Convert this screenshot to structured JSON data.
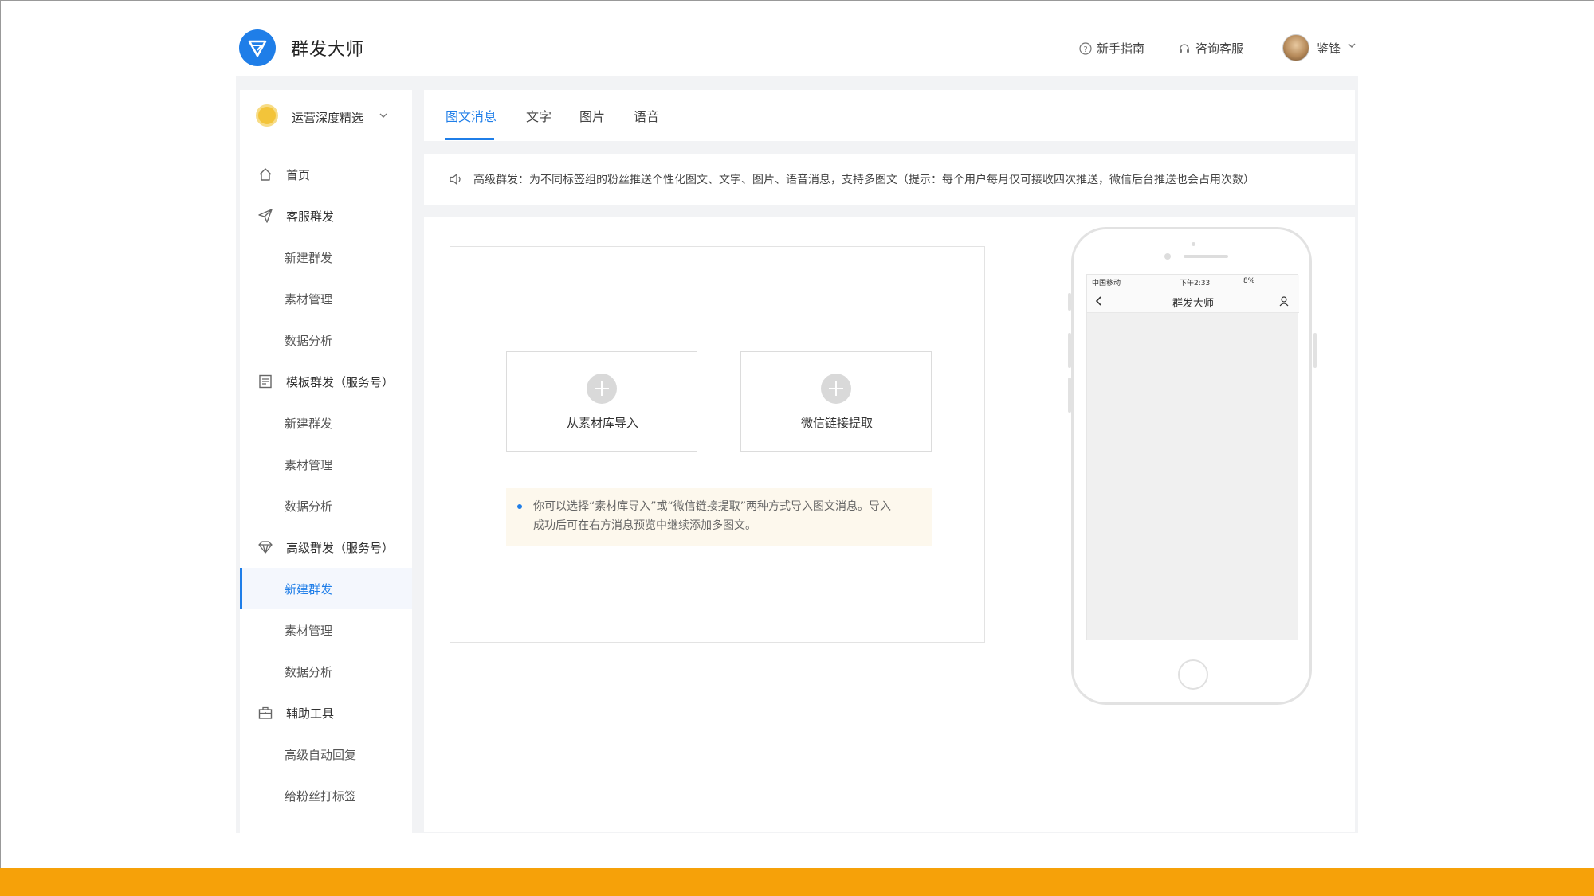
{
  "app": {
    "title": "群发大师",
    "brand_color": "#1f7ee8",
    "accent_bar_color": "#f6a109"
  },
  "header": {
    "guide_label": "新手指南",
    "guide_icon": "question-circle-icon",
    "support_label": "咨询客服",
    "support_icon": "headset-icon",
    "user_name": "鉴锋"
  },
  "sidebar": {
    "account_name": "运营深度精选",
    "items": [
      {
        "type": "group",
        "icon": "home-icon",
        "label": "首页"
      },
      {
        "type": "group",
        "icon": "send-icon",
        "label": "客服群发"
      },
      {
        "type": "item",
        "label": "新建群发"
      },
      {
        "type": "item",
        "label": "素材管理"
      },
      {
        "type": "item",
        "label": "数据分析"
      },
      {
        "type": "group",
        "icon": "document-icon",
        "label": "模板群发（服务号）"
      },
      {
        "type": "item",
        "label": "新建群发"
      },
      {
        "type": "item",
        "label": "素材管理"
      },
      {
        "type": "item",
        "label": "数据分析"
      },
      {
        "type": "group",
        "icon": "diamond-icon",
        "label": "高级群发（服务号）"
      },
      {
        "type": "item",
        "label": "新建群发",
        "active": true
      },
      {
        "type": "item",
        "label": "素材管理"
      },
      {
        "type": "item",
        "label": "数据分析"
      },
      {
        "type": "group",
        "icon": "toolbox-icon",
        "label": "辅助工具"
      },
      {
        "type": "item",
        "label": "高级自动回复"
      },
      {
        "type": "item",
        "label": "给粉丝打标签"
      }
    ]
  },
  "tabs": [
    {
      "label": "图文消息",
      "active": true
    },
    {
      "label": "文字"
    },
    {
      "label": "图片"
    },
    {
      "label": "语音"
    }
  ],
  "notice": {
    "icon": "speaker-icon",
    "text": "高级群发：为不同标签组的粉丝推送个性化图文、文字、图片、语音消息，支持多图文（提示：每个用户每月仅可接收四次推送，微信后台推送也会占用次数）"
  },
  "editor": {
    "import_library_label": "从素材库导入",
    "import_link_label": "微信链接提取",
    "tip_line1": "你可以选择“素材库导入”或“微信链接提取”两种方式导入图文消息。导入",
    "tip_line2": "成功后可在右方消息预览中继续添加多图文。"
  },
  "preview": {
    "carrier": "中国移动",
    "time": "下午2:33",
    "battery": "8%",
    "title": "群发大师"
  }
}
